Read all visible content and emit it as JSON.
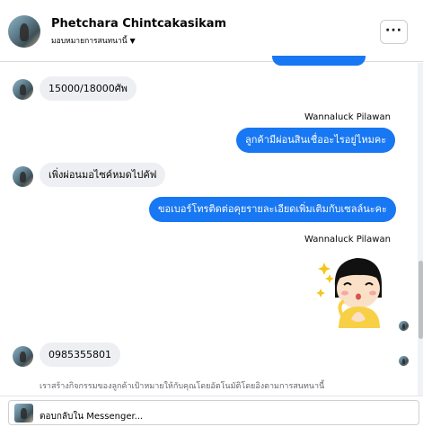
{
  "header": {
    "name": "Phetchara Chintcakasikam",
    "subtitle": "มอบหมายการสนทนานี้",
    "more_label": "···"
  },
  "messages": [
    {
      "kind": "incoming",
      "text": "15000/18000ศัพ"
    },
    {
      "kind": "sender",
      "text": "Wannaluck Pilawan"
    },
    {
      "kind": "outgoing",
      "text": "ลูกค้ามีผ่อนสินเชื่ออะไรอยู่ไหมคะ"
    },
    {
      "kind": "incoming",
      "text": "เพิ่งผ่อนมอไซค์หมดไปคัฟ"
    },
    {
      "kind": "outgoing",
      "text": "ขอเบอร์โทรติดต่อคุยรายละเอียดเพิ่มเติมกับเซลล์นะคะ"
    },
    {
      "kind": "sender",
      "text": "Wannaluck Pilawan"
    },
    {
      "kind": "incoming",
      "text": "0985355801"
    }
  ],
  "notice": "เราสร้างกิจกรรมของลูกค้าเป้าหมายให้กับคุณโดยอัตโนมัติโดยอิงตามการสนทนานี้",
  "composer": {
    "placeholder": "ตอบกลับใน Messenger..."
  },
  "colors": {
    "outgoing_bubble": "#1877f2",
    "incoming_bubble": "#eeeff2"
  }
}
